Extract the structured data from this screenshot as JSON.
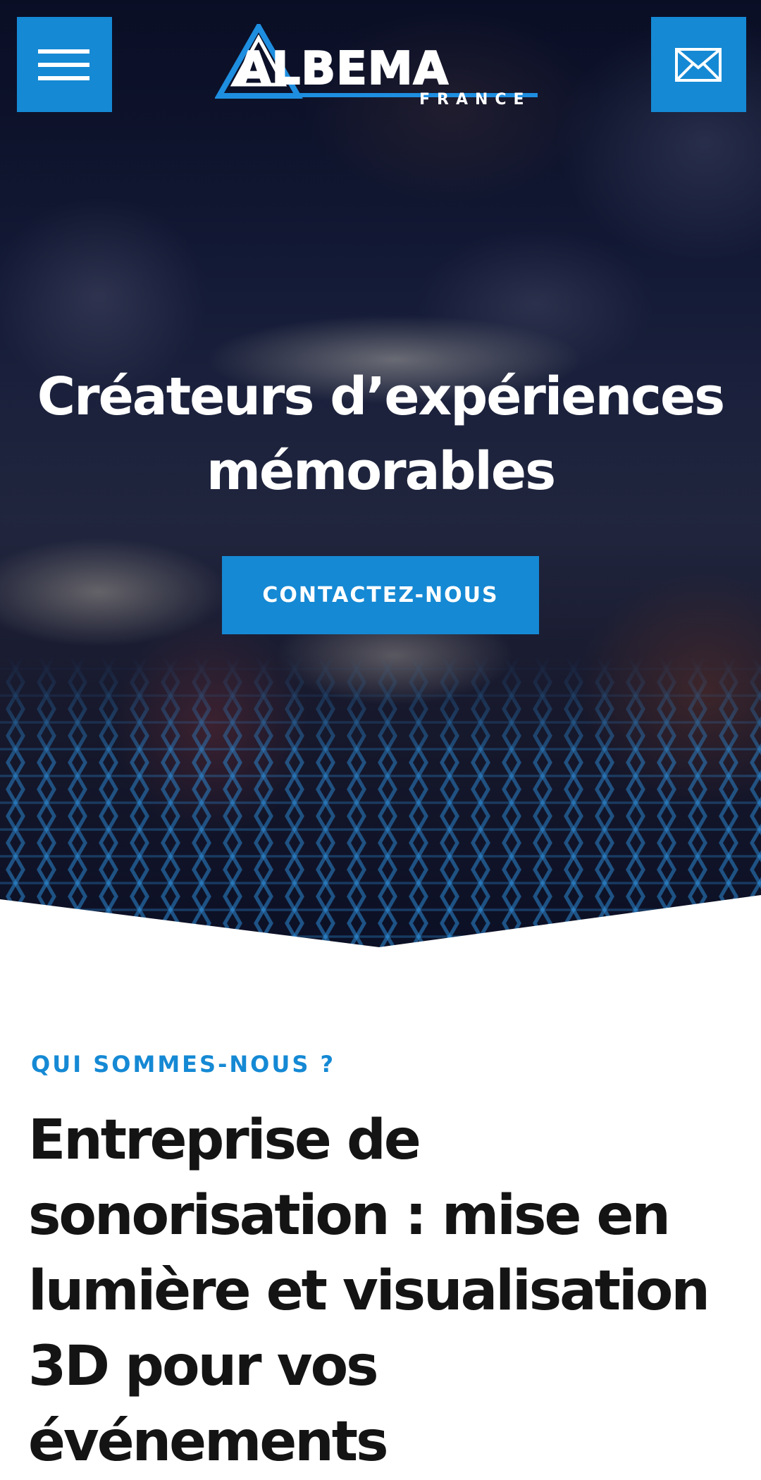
{
  "header": {
    "logo_main": "ALBEMA",
    "logo_sub": "FRANCE",
    "menu_icon": "hamburger-menu-icon",
    "mail_icon": "envelope-icon"
  },
  "hero": {
    "title": "Créateurs d’expériences mémorables",
    "cta_label": "CONTACTEZ-NOUS"
  },
  "about": {
    "eyebrow": "QUI SOMMES-NOUS ?",
    "title": "Entreprise de sonorisation : mise en lumière et visualisation 3D pour vos événements"
  },
  "colors": {
    "accent": "#1589d4",
    "hero_dark": "#0c1128",
    "title_text": "#141414"
  }
}
